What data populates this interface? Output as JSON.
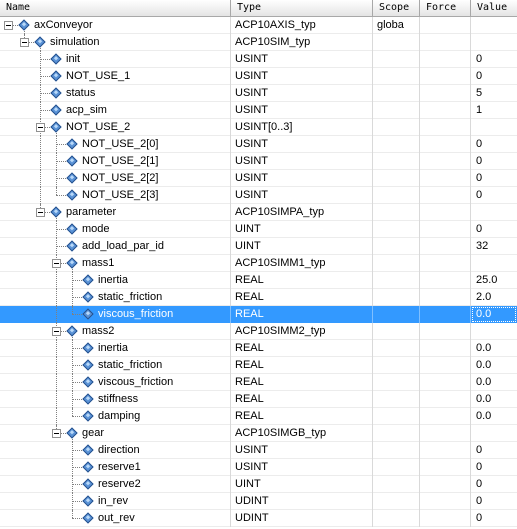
{
  "columns": {
    "name": "Name",
    "type": "Type",
    "scope": "Scope",
    "force": "Force",
    "value": "Value"
  },
  "selected_row": 17,
  "rows": [
    {
      "name": "axConveyor",
      "type": "ACP10AXIS_typ",
      "scope": "globa",
      "value": "",
      "level": 0,
      "expandable": true
    },
    {
      "name": "simulation",
      "type": "ACP10SIM_typ",
      "scope": "",
      "value": "",
      "level": 1,
      "expandable": true
    },
    {
      "name": "init",
      "type": "USINT",
      "scope": "",
      "value": "0",
      "level": 2,
      "expandable": false
    },
    {
      "name": "NOT_USE_1",
      "type": "USINT",
      "scope": "",
      "value": "0",
      "level": 2,
      "expandable": false
    },
    {
      "name": "status",
      "type": "USINT",
      "scope": "",
      "value": "5",
      "level": 2,
      "expandable": false
    },
    {
      "name": "acp_sim",
      "type": "USINT",
      "scope": "",
      "value": "1",
      "level": 2,
      "expandable": false
    },
    {
      "name": "NOT_USE_2",
      "type": "USINT[0..3]",
      "scope": "",
      "value": "",
      "level": 2,
      "expandable": true
    },
    {
      "name": "NOT_USE_2[0]",
      "type": "USINT",
      "scope": "",
      "value": "0",
      "level": 3,
      "expandable": false
    },
    {
      "name": "NOT_USE_2[1]",
      "type": "USINT",
      "scope": "",
      "value": "0",
      "level": 3,
      "expandable": false
    },
    {
      "name": "NOT_USE_2[2]",
      "type": "USINT",
      "scope": "",
      "value": "0",
      "level": 3,
      "expandable": false
    },
    {
      "name": "NOT_USE_2[3]",
      "type": "USINT",
      "scope": "",
      "value": "0",
      "level": 3,
      "expandable": false
    },
    {
      "name": "parameter",
      "type": "ACP10SIMPA_typ",
      "scope": "",
      "value": "",
      "level": 2,
      "expandable": true
    },
    {
      "name": "mode",
      "type": "UINT",
      "scope": "",
      "value": "0",
      "level": 3,
      "expandable": false
    },
    {
      "name": "add_load_par_id",
      "type": "UINT",
      "scope": "",
      "value": "32",
      "level": 3,
      "expandable": false
    },
    {
      "name": "mass1",
      "type": "ACP10SIMM1_typ",
      "scope": "",
      "value": "",
      "level": 3,
      "expandable": true
    },
    {
      "name": "inertia",
      "type": "REAL",
      "scope": "",
      "value": "25.0",
      "level": 4,
      "expandable": false
    },
    {
      "name": "static_friction",
      "type": "REAL",
      "scope": "",
      "value": "2.0",
      "level": 4,
      "expandable": false
    },
    {
      "name": "viscous_friction",
      "type": "REAL",
      "scope": "",
      "value": "0.0",
      "level": 4,
      "expandable": false
    },
    {
      "name": "mass2",
      "type": "ACP10SIMM2_typ",
      "scope": "",
      "value": "",
      "level": 3,
      "expandable": true
    },
    {
      "name": "inertia",
      "type": "REAL",
      "scope": "",
      "value": "0.0",
      "level": 4,
      "expandable": false
    },
    {
      "name": "static_friction",
      "type": "REAL",
      "scope": "",
      "value": "0.0",
      "level": 4,
      "expandable": false
    },
    {
      "name": "viscous_friction",
      "type": "REAL",
      "scope": "",
      "value": "0.0",
      "level": 4,
      "expandable": false
    },
    {
      "name": "stiffness",
      "type": "REAL",
      "scope": "",
      "value": "0.0",
      "level": 4,
      "expandable": false
    },
    {
      "name": "damping",
      "type": "REAL",
      "scope": "",
      "value": "0.0",
      "level": 4,
      "expandable": false
    },
    {
      "name": "gear",
      "type": "ACP10SIMGB_typ",
      "scope": "",
      "value": "",
      "level": 3,
      "expandable": true
    },
    {
      "name": "direction",
      "type": "USINT",
      "scope": "",
      "value": "0",
      "level": 4,
      "expandable": false
    },
    {
      "name": "reserve1",
      "type": "USINT",
      "scope": "",
      "value": "0",
      "level": 4,
      "expandable": false
    },
    {
      "name": "reserve2",
      "type": "UINT",
      "scope": "",
      "value": "0",
      "level": 4,
      "expandable": false
    },
    {
      "name": "in_rev",
      "type": "UDINT",
      "scope": "",
      "value": "0",
      "level": 4,
      "expandable": false
    },
    {
      "name": "out_rev",
      "type": "UDINT",
      "scope": "",
      "value": "0",
      "level": 4,
      "expandable": false
    }
  ]
}
